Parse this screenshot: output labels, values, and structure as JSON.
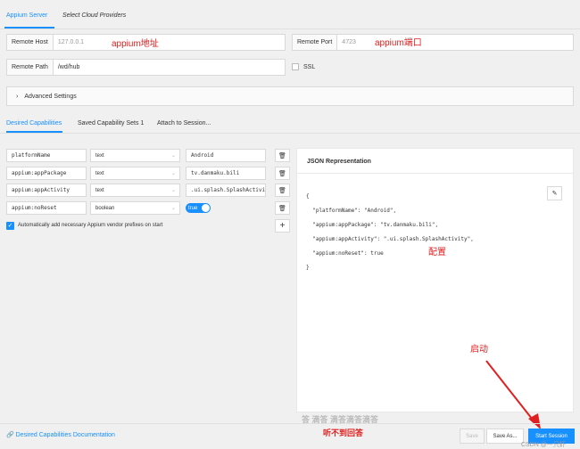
{
  "tabs": {
    "appium_server": "Appium Server",
    "cloud_providers": "Select Cloud Providers"
  },
  "server": {
    "remote_host_label": "Remote Host",
    "remote_host_placeholder": "127.0.0.1",
    "remote_port_label": "Remote Port",
    "remote_port_placeholder": "4723",
    "remote_path_label": "Remote Path",
    "remote_path_value": "/wd/hub",
    "ssl_label": "SSL",
    "advanced_settings": "Advanced Settings"
  },
  "annotations": {
    "host_note": "appium地址",
    "port_note": "appium端口",
    "config_note": "配置",
    "start_note": "启动",
    "answer_line": "答 滴答  滴答滴答滴答",
    "cant_hear": "听不到回答"
  },
  "cap_tabs": {
    "desired": "Desired Capabilities",
    "saved": "Saved Capability Sets 1",
    "attach": "Attach to Session..."
  },
  "capabilities": [
    {
      "name": "platformName",
      "type": "text",
      "value": "Android"
    },
    {
      "name": "appium:appPackage",
      "type": "text",
      "value": "tv.danmaku.bili"
    },
    {
      "name": "appium:appActivity",
      "type": "text",
      "value": ".ui.splash.SplashActivity"
    },
    {
      "name": "appium:noReset",
      "type": "boolean",
      "value": "true"
    }
  ],
  "auto_prefix_label": "Automatically add necessary Appium vendor prefixes on start",
  "json_panel": {
    "title": "JSON Representation",
    "lines": [
      "{",
      "  \"platformName\": \"Android\",",
      "  \"appium:appPackage\": \"tv.danmaku.bili\",",
      "  \"appium:appActivity\": \".ui.splash.SplashActivity\",",
      "  \"appium:noReset\": true",
      "}"
    ]
  },
  "footer": {
    "docs_link": "Desired Capabilities Documentation",
    "save": "Save",
    "save_as": "Save As...",
    "start_session": "Start Session",
    "watermark": "CSDN @一只虾"
  },
  "colors": {
    "accent": "#1890ff",
    "annotation": "#e02020"
  }
}
